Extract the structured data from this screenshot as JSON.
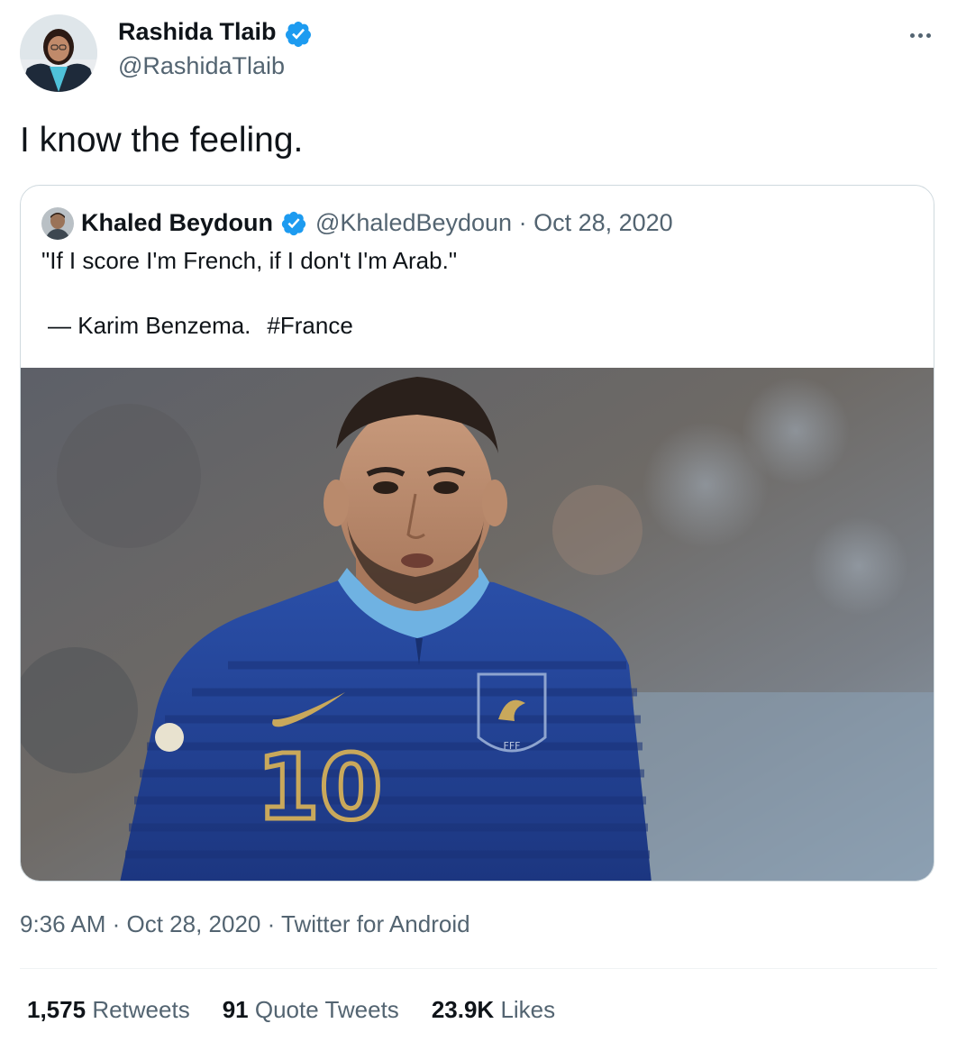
{
  "tweet": {
    "author": {
      "name": "Rashida Tlaib",
      "handle": "@RashidaTlaib"
    },
    "text": "I know the feeling.",
    "quoted": {
      "author_name": "Khaled Beydoun",
      "meta": "@KhaledBeydoun · Oct 28, 2020",
      "line1": "\"If I score I'm French, if I don't I'm Arab.\"",
      "attribution": "— Karim Benzema.",
      "hashtag": "#France",
      "image": {
        "jersey_number": "10",
        "crest_text": "FFF"
      }
    },
    "timestamp": "9:36 AM · Oct 28, 2020 · ",
    "source": "Twitter for Android",
    "stats": {
      "retweets_count": "1,575",
      "retweets_label": "Retweets",
      "quotes_count": "91",
      "quotes_label": "Quote Tweets",
      "likes_count": "23.9K",
      "likes_label": "Likes"
    }
  },
  "colors": {
    "text_primary": "#0f1419",
    "text_secondary": "#536471",
    "verified": "#1d9bf0",
    "border": "#cfd9de",
    "jersey": "#1f3f8e"
  },
  "icons": [
    "verified-badge-icon",
    "more-options-icon"
  ]
}
